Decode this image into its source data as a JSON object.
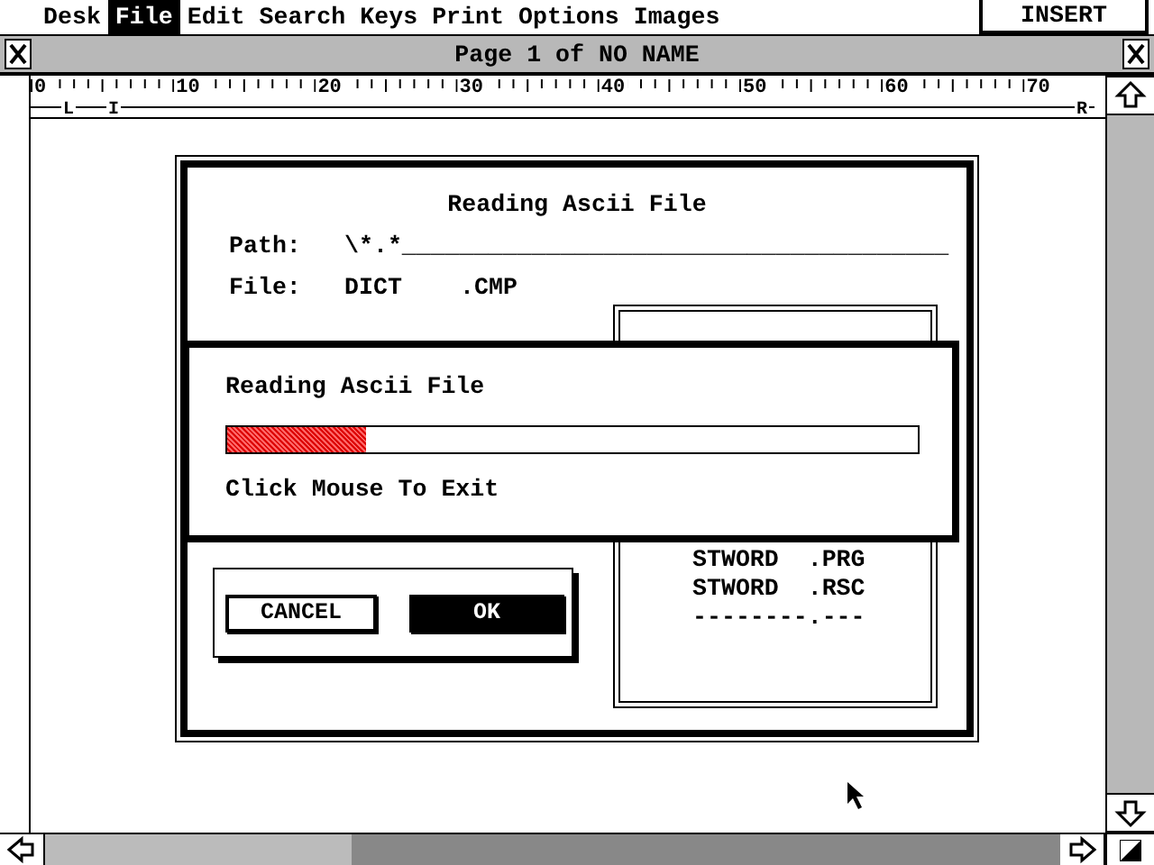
{
  "menu_bar": {
    "items": [
      {
        "label": "Desk",
        "selected": false
      },
      {
        "label": "File",
        "selected": true
      },
      {
        "label": "Edit",
        "selected": false
      },
      {
        "label": "Search",
        "selected": false
      },
      {
        "label": "Keys",
        "selected": false
      },
      {
        "label": "Print",
        "selected": false
      },
      {
        "label": "Options",
        "selected": false
      },
      {
        "label": "Images",
        "selected": false
      }
    ],
    "mode": "INSERT"
  },
  "window": {
    "title": "Page 1 of NO NAME",
    "ruler": {
      "numbers": [
        "0",
        "10",
        "20",
        "30",
        "40",
        "50",
        "60",
        "70"
      ],
      "markers": [
        "L",
        "I",
        "R"
      ]
    }
  },
  "file_selector": {
    "title": "Reading Ascii File",
    "path_label": "Path:",
    "path": "\\*.*______________________________________",
    "file_label": "File:",
    "file_name": "DICT",
    "file_ext": ".CMP",
    "files": [
      {
        "name": "STWORD",
        "ext": ".PRG"
      },
      {
        "name": "STWORD",
        "ext": ".RSC"
      },
      {
        "name": "--------",
        "ext": ".---"
      }
    ],
    "buttons": [
      {
        "label": "CANCEL",
        "default": false
      },
      {
        "label": "OK",
        "default": true
      }
    ]
  },
  "progress": {
    "title": "Reading Ascii File",
    "level": 0.2,
    "hint": "Click Mouse To Exit"
  }
}
